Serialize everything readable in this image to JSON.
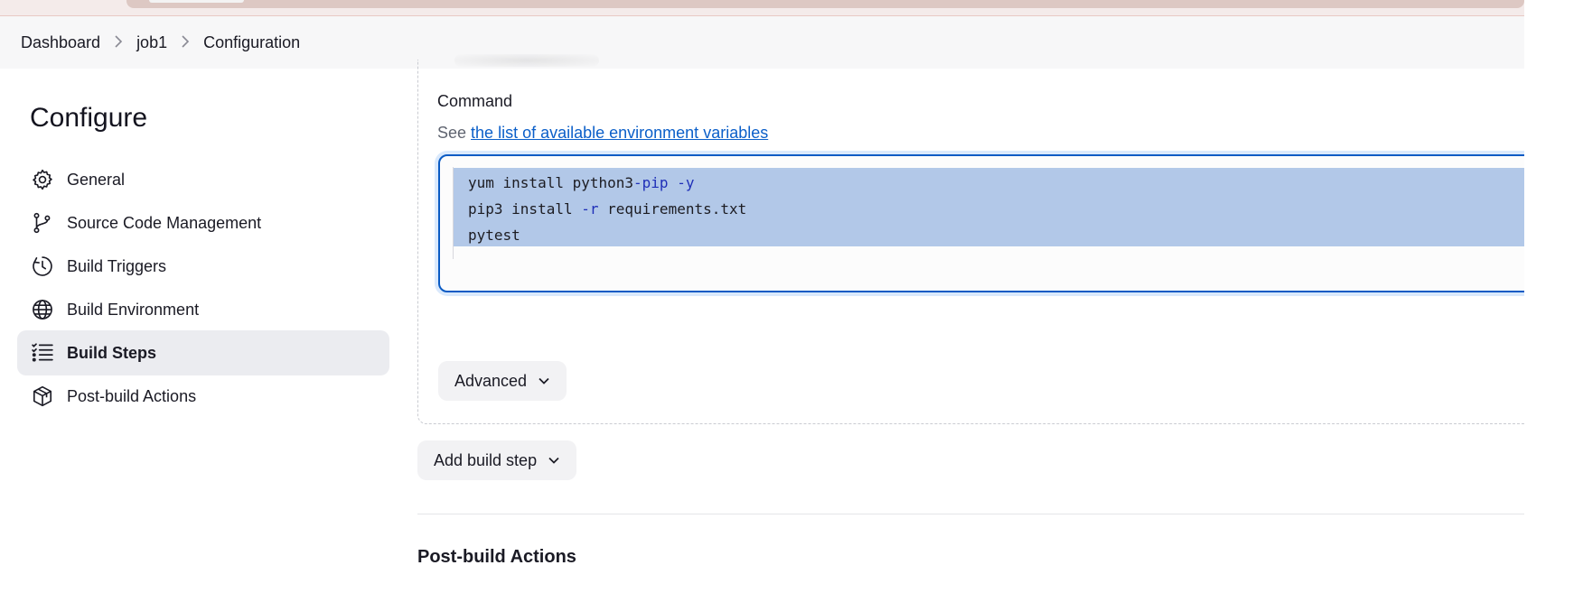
{
  "breadcrumb": {
    "items": [
      "Dashboard",
      "job1",
      "Configuration"
    ],
    "separator": ">"
  },
  "sidebar": {
    "title": "Configure",
    "items": [
      {
        "label": "General",
        "icon": "gear-icon",
        "active": false
      },
      {
        "label": "Source Code Management",
        "icon": "git-branch-icon",
        "active": false
      },
      {
        "label": "Build Triggers",
        "icon": "clock-icon",
        "active": false
      },
      {
        "label": "Build Environment",
        "icon": "globe-icon",
        "active": false
      },
      {
        "label": "Build Steps",
        "icon": "list-icon",
        "active": true
      },
      {
        "label": "Post-build Actions",
        "icon": "package-icon",
        "active": false
      }
    ]
  },
  "main": {
    "command_label": "Command",
    "help_prefix": "See",
    "help_link": "the list of available environment variables",
    "command_lines": [
      {
        "parts": [
          {
            "t": "yum install python3",
            "c": "plain"
          },
          {
            "t": "-pip",
            "c": "kw"
          },
          {
            "t": " ",
            "c": "plain"
          },
          {
            "t": "-y",
            "c": "kw"
          }
        ]
      },
      {
        "parts": [
          {
            "t": "pip3 install ",
            "c": "plain"
          },
          {
            "t": "-r",
            "c": "kw"
          },
          {
            "t": " requirements.txt",
            "c": "plain"
          }
        ]
      },
      {
        "parts": [
          {
            "t": "pytest",
            "c": "plain"
          }
        ]
      }
    ],
    "advanced_label": "Advanced",
    "add_build_step_label": "Add build step",
    "post_build_title": "Post-build Actions"
  },
  "colors": {
    "accent": "#0a5bc4",
    "selection": "#b2c8e8",
    "link": "#0b5fc9",
    "active_nav_bg": "#ebecf0",
    "keyword": "#1f2fb8"
  }
}
